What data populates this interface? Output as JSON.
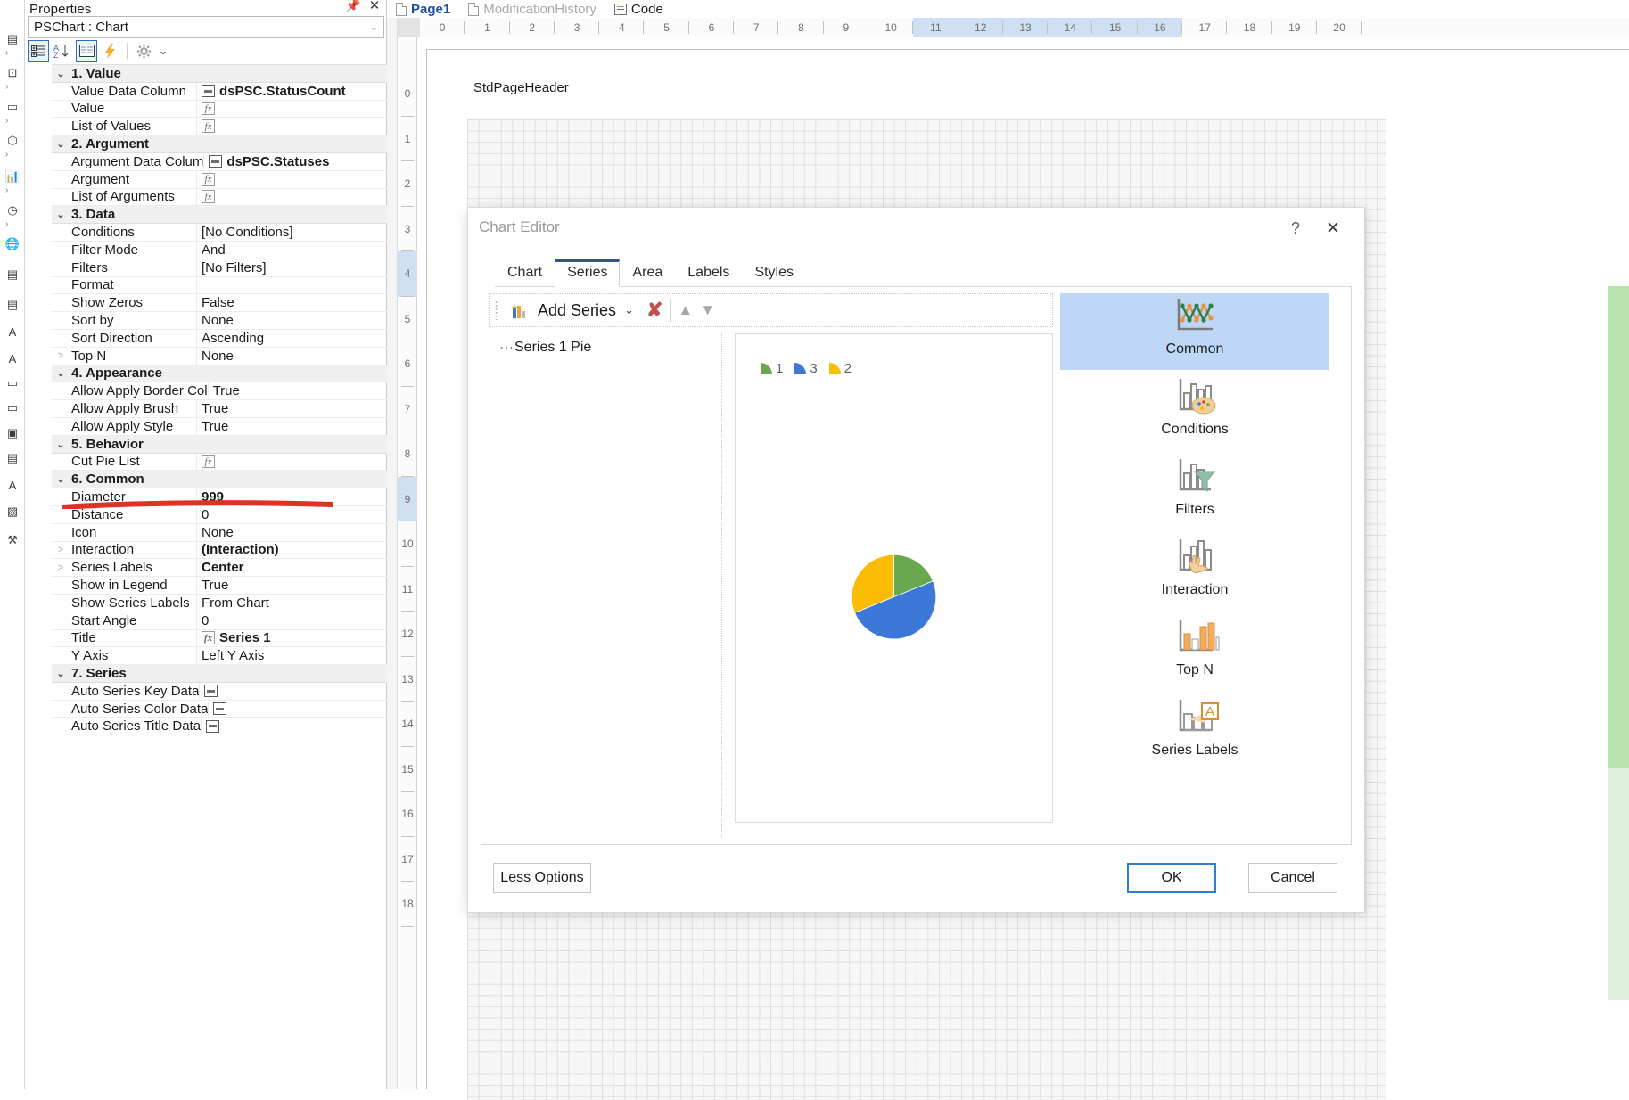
{
  "properties_panel": {
    "title": "Properties",
    "pin_icon": "pin-icon",
    "close_icon": "close-icon",
    "object_selector": {
      "value": "PSChart : Chart",
      "caret": "⌄"
    },
    "toolbar": {
      "categorized_icon": "categorized-view-icon",
      "alphabetical_icon": "alphabetical-sort-icon",
      "property_pages_icon": "property-pages-icon",
      "events_icon": "events-lightning-icon",
      "settings_icon": "gear-icon",
      "settings_caret": "⌄"
    },
    "groups": [
      {
        "name": "1. Value",
        "expanded": true,
        "rows": [
          {
            "name": "Value Data Column",
            "value": "dsPSC.StatusCount",
            "bold": true,
            "icon": "column-icon",
            "overflow": false
          },
          {
            "name": "Value",
            "value": "",
            "bold": false,
            "icon": "fx-icon"
          },
          {
            "name": "List of Values",
            "value": "",
            "bold": false,
            "icon": "fx-icon"
          }
        ]
      },
      {
        "name": "2. Argument",
        "expanded": true,
        "rows": [
          {
            "name": "Argument Data Colum",
            "value": "dsPSC.Statuses",
            "bold": true,
            "icon": "column-icon",
            "overflow": true
          },
          {
            "name": "Argument",
            "value": "",
            "bold": false,
            "icon": "fx-icon"
          },
          {
            "name": "List of Arguments",
            "value": "",
            "bold": false,
            "icon": "fx-icon"
          }
        ]
      },
      {
        "name": "3. Data",
        "expanded": true,
        "rows": [
          {
            "name": "Conditions",
            "value": "[No Conditions]",
            "bold": false,
            "icon": ""
          },
          {
            "name": "Filter Mode",
            "value": "And",
            "bold": false,
            "icon": ""
          },
          {
            "name": "Filters",
            "value": "[No Filters]",
            "bold": false,
            "icon": ""
          },
          {
            "name": "Format",
            "value": "",
            "bold": false,
            "icon": ""
          },
          {
            "name": "Show Zeros",
            "value": "False",
            "bold": false,
            "icon": ""
          },
          {
            "name": "Sort by",
            "value": "None",
            "bold": false,
            "icon": ""
          },
          {
            "name": "Sort Direction",
            "value": "Ascending",
            "bold": false,
            "icon": ""
          },
          {
            "name": "Top N",
            "value": "None",
            "bold": false,
            "icon": "",
            "expander": ">"
          }
        ]
      },
      {
        "name": "4. Appearance",
        "expanded": true,
        "rows": [
          {
            "name": "Allow Apply Border Col",
            "value": "True",
            "bold": false,
            "icon": "",
            "overflow": true
          },
          {
            "name": "Allow Apply Brush",
            "value": "True",
            "bold": false,
            "icon": ""
          },
          {
            "name": "Allow Apply Style",
            "value": "True",
            "bold": false,
            "icon": ""
          }
        ]
      },
      {
        "name": "5. Behavior",
        "expanded": true,
        "rows": [
          {
            "name": "Cut Pie List",
            "value": "",
            "bold": false,
            "icon": "fx-icon"
          }
        ]
      },
      {
        "name": "6. Common",
        "expanded": true,
        "rows": [
          {
            "name": "Diameter",
            "value": "999",
            "bold": true,
            "icon": ""
          },
          {
            "name": "Distance",
            "value": "0",
            "bold": false,
            "icon": ""
          },
          {
            "name": "Icon",
            "value": "None",
            "bold": false,
            "icon": ""
          },
          {
            "name": "Interaction",
            "value": "(Interaction)",
            "bold": true,
            "icon": "",
            "expander": ">"
          },
          {
            "name": "Series Labels",
            "value": "Center",
            "bold": true,
            "icon": "",
            "expander": ">"
          },
          {
            "name": "Show in Legend",
            "value": "True",
            "bold": false,
            "icon": ""
          },
          {
            "name": "Show Series Labels",
            "value": "From Chart",
            "bold": false,
            "icon": ""
          },
          {
            "name": "Start Angle",
            "value": "0",
            "bold": false,
            "icon": ""
          },
          {
            "name": "Title",
            "value": "Series 1",
            "bold": true,
            "icon": "fx-icon"
          },
          {
            "name": "Y Axis",
            "value": "Left Y Axis",
            "bold": false,
            "icon": ""
          }
        ]
      },
      {
        "name": "7. Series",
        "expanded": true,
        "rows": [
          {
            "name": "Auto Series Key Data ",
            "value": "",
            "bold": false,
            "icon": "column-icon",
            "overflow": true
          },
          {
            "name": "Auto Series Color Data",
            "value": "",
            "bold": false,
            "icon": "column-icon",
            "overflow": true
          },
          {
            "name": "Auto Series Title Data",
            "value": "",
            "bold": false,
            "icon": "column-icon",
            "overflow": true
          }
        ]
      }
    ],
    "annotation": {
      "type": "red-underline",
      "target_row": "Diameter",
      "color": "#e03127"
    }
  },
  "design_surface": {
    "tabs": [
      {
        "label": "Page1",
        "icon": "page-icon",
        "active": true,
        "dim": false
      },
      {
        "label": "ModificationHistory",
        "icon": "page-icon",
        "active": false,
        "dim": true
      },
      {
        "label": "Code",
        "icon": "code-icon",
        "active": false,
        "dim": false
      }
    ],
    "h_ruler_ticks": [
      "0",
      "1",
      "2",
      "3",
      "4",
      "5",
      "6",
      "7",
      "8",
      "9",
      "10",
      "11",
      "12",
      "13",
      "14",
      "15",
      "16",
      "17",
      "18",
      "19",
      "20"
    ],
    "h_ruler_selected": [
      "11",
      "12",
      "13",
      "14",
      "15",
      "16"
    ],
    "v_ruler_ticks": [
      "0",
      "1",
      "2",
      "3",
      "4",
      "5",
      "6",
      "7",
      "8",
      "9",
      "10",
      "11",
      "12",
      "13",
      "14",
      "15",
      "16",
      "17",
      "18"
    ],
    "v_ruler_selected": [
      "4",
      "9"
    ],
    "band_label": "StdPageHeader"
  },
  "dialog": {
    "title": "Chart Editor",
    "help_icon": "help-question-icon",
    "close_icon": "close-icon",
    "tabs": [
      {
        "label": "Chart",
        "active": false
      },
      {
        "label": "Series",
        "active": true
      },
      {
        "label": "Area",
        "active": false
      },
      {
        "label": "Labels",
        "active": false
      },
      {
        "label": "Styles",
        "active": false
      }
    ],
    "toolbar": {
      "add_series_label": "Add Series",
      "add_series_icon": "add-series-chart-icon",
      "add_series_caret": "⌄",
      "delete_icon": "delete-x-icon",
      "move_up_icon": "arrow-up-icon",
      "move_down_icon": "arrow-down-icon"
    },
    "series_tree": [
      {
        "label": "Series 1 Pie"
      }
    ],
    "rail": [
      {
        "label": "Common",
        "icon": "line-chart-icon",
        "selected": true
      },
      {
        "label": "Conditions",
        "icon": "bar-chart-palette-icon",
        "selected": false
      },
      {
        "label": "Filters",
        "icon": "bar-chart-funnel-icon",
        "selected": false
      },
      {
        "label": "Interaction",
        "icon": "bar-chart-hand-icon",
        "selected": false
      },
      {
        "label": "Top N",
        "icon": "bar-chart-orange-icon",
        "selected": false
      },
      {
        "label": "Series Labels",
        "icon": "bar-chart-label-a-icon",
        "selected": false
      }
    ],
    "footer": {
      "less_options": "Less Options",
      "ok": "OK",
      "cancel": "Cancel"
    }
  },
  "chart_data": {
    "type": "pie",
    "title": "",
    "categories": [
      "1",
      "3",
      "2"
    ],
    "values": [
      17,
      45,
      28
    ],
    "colors": [
      "#6aa84f",
      "#3c78d8",
      "#fbbc04"
    ],
    "legend": [
      {
        "label": "1",
        "color": "#6aa84f"
      },
      {
        "label": "3",
        "color": "#3c78d8"
      },
      {
        "label": "2",
        "color": "#fbbc04"
      }
    ],
    "legend_position": "top-left",
    "start_angle": 0,
    "show_labels": false,
    "grid": false
  }
}
